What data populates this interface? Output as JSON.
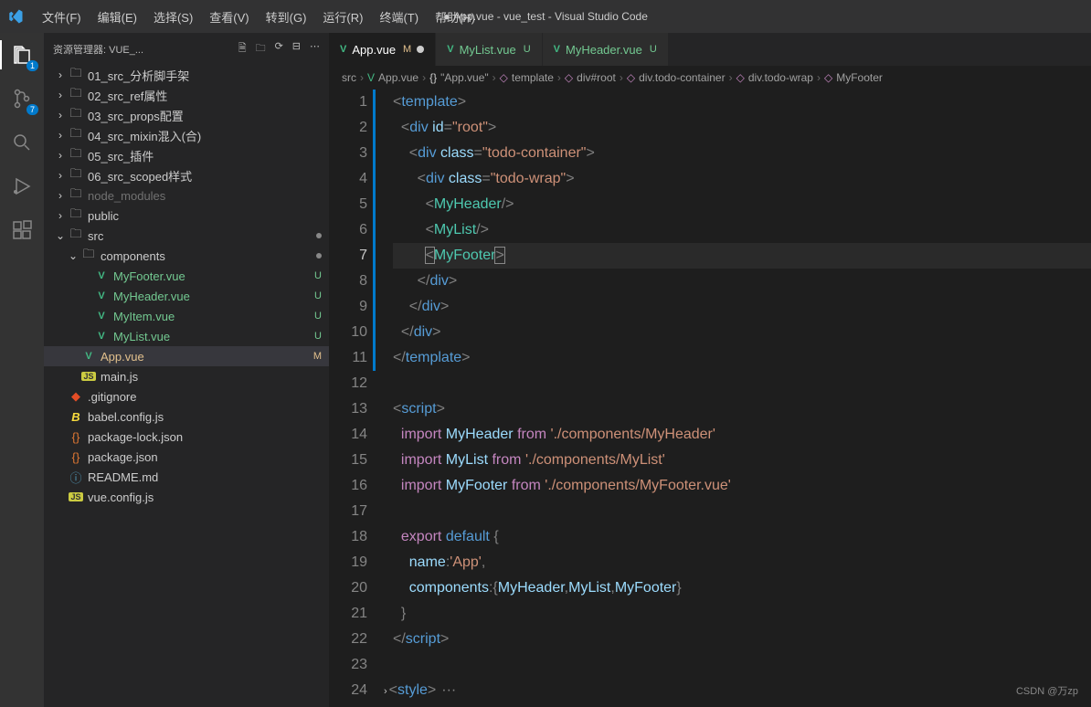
{
  "title": {
    "dirty": "●",
    "text": "App.vue - vue_test - Visual Studio Code"
  },
  "menu": [
    "文件(F)",
    "编辑(E)",
    "选择(S)",
    "查看(V)",
    "转到(G)",
    "运行(R)",
    "终端(T)",
    "帮助(H)"
  ],
  "activity": {
    "explorer_badge": "1",
    "scm_badge": "7"
  },
  "sidebar": {
    "title": "资源管理器: VUE_...",
    "tree": [
      {
        "indent": 0,
        "chevron": "›",
        "type": "folder",
        "label": "01_src_分析脚手架"
      },
      {
        "indent": 0,
        "chevron": "›",
        "type": "folder",
        "label": "02_src_ref属性"
      },
      {
        "indent": 0,
        "chevron": "›",
        "type": "folder",
        "label": "03_src_props配置"
      },
      {
        "indent": 0,
        "chevron": "›",
        "type": "folder",
        "label": "04_src_mixin混入(合)"
      },
      {
        "indent": 0,
        "chevron": "›",
        "type": "folder",
        "label": "05_src_插件"
      },
      {
        "indent": 0,
        "chevron": "›",
        "type": "folder",
        "label": "06_src_scoped样式"
      },
      {
        "indent": 0,
        "chevron": "›",
        "type": "folder",
        "label": "node_modules",
        "dim": true
      },
      {
        "indent": 0,
        "chevron": "›",
        "type": "folder",
        "label": "public"
      },
      {
        "indent": 0,
        "chevron": "⌄",
        "type": "folder",
        "label": "src",
        "dot": true
      },
      {
        "indent": 1,
        "chevron": "⌄",
        "type": "folder",
        "label": "components",
        "dot": true
      },
      {
        "indent": 2,
        "chevron": "",
        "type": "vue",
        "label": "MyFooter.vue",
        "badge": "U",
        "green": true
      },
      {
        "indent": 2,
        "chevron": "",
        "type": "vue",
        "label": "MyHeader.vue",
        "badge": "U",
        "green": true
      },
      {
        "indent": 2,
        "chevron": "",
        "type": "vue",
        "label": "MyItem.vue",
        "badge": "U",
        "green": true
      },
      {
        "indent": 2,
        "chevron": "",
        "type": "vue",
        "label": "MyList.vue",
        "badge": "U",
        "green": true
      },
      {
        "indent": 1,
        "chevron": "",
        "type": "vue",
        "label": "App.vue",
        "badge": "M",
        "selected": true,
        "yellow": true
      },
      {
        "indent": 1,
        "chevron": "",
        "type": "js",
        "label": "main.js"
      },
      {
        "indent": 0,
        "chevron": "",
        "type": "git",
        "label": ".gitignore"
      },
      {
        "indent": 0,
        "chevron": "",
        "type": "babel",
        "label": "babel.config.js"
      },
      {
        "indent": 0,
        "chevron": "",
        "type": "json",
        "label": "package-lock.json"
      },
      {
        "indent": 0,
        "chevron": "",
        "type": "json",
        "label": "package.json"
      },
      {
        "indent": 0,
        "chevron": "",
        "type": "md",
        "label": "README.md"
      },
      {
        "indent": 0,
        "chevron": "",
        "type": "js",
        "label": "vue.config.js"
      }
    ]
  },
  "tabs": [
    {
      "icon": "V",
      "label": "App.vue",
      "status": "M",
      "dirty": true,
      "active": true
    },
    {
      "icon": "V",
      "label": "MyList.vue",
      "status": "U"
    },
    {
      "icon": "V",
      "label": "MyHeader.vue",
      "status": "U"
    }
  ],
  "breadcrumbs": [
    {
      "label": "src"
    },
    {
      "icon": "V",
      "label": "App.vue",
      "cls": "file"
    },
    {
      "icon": "{}",
      "label": "\"App.vue\"",
      "cls": "brace"
    },
    {
      "icon": "◇",
      "label": "template"
    },
    {
      "icon": "◇",
      "label": "div#root"
    },
    {
      "icon": "◇",
      "label": "div.todo-container"
    },
    {
      "icon": "◇",
      "label": "div.todo-wrap"
    },
    {
      "icon": "◇",
      "label": "MyFooter"
    }
  ],
  "code": {
    "lines": [
      {
        "n": 1,
        "html": "<span class='tok-punct'>&lt;</span><span class='tok-tag'>template</span><span class='tok-punct'>&gt;</span>"
      },
      {
        "n": 2,
        "html": "  <span class='tok-punct'>&lt;</span><span class='tok-tag'>div</span> <span class='tok-attr'>id</span><span class='tok-punct'>=</span><span class='tok-str'>\"root\"</span><span class='tok-punct'>&gt;</span>"
      },
      {
        "n": 3,
        "html": "    <span class='tok-punct'>&lt;</span><span class='tok-tag'>div</span> <span class='tok-attr'>class</span><span class='tok-punct'>=</span><span class='tok-str'>\"todo-container\"</span><span class='tok-punct'>&gt;</span>"
      },
      {
        "n": 4,
        "html": "      <span class='tok-punct'>&lt;</span><span class='tok-tag'>div</span> <span class='tok-attr'>class</span><span class='tok-punct'>=</span><span class='tok-str'>\"todo-wrap\"</span><span class='tok-punct'>&gt;</span>"
      },
      {
        "n": 5,
        "html": "        <span class='tok-punct'>&lt;</span><span class='tok-comp'>MyHeader</span><span class='tok-punct'>/&gt;</span>"
      },
      {
        "n": 6,
        "html": "        <span class='tok-punct'>&lt;</span><span class='tok-comp'>MyList</span><span class='tok-punct'>/&gt;</span>"
      },
      {
        "n": 7,
        "active": true,
        "html": "        <span class='cursor-box'><span class='tok-punct'>&lt;</span></span><span class='tok-comp'>MyFooter</span><span class='cursor-box'><span class='tok-punct'>&gt;</span></span>"
      },
      {
        "n": 8,
        "html": "      <span class='tok-punct'>&lt;/</span><span class='tok-tag'>div</span><span class='tok-punct'>&gt;</span>"
      },
      {
        "n": 9,
        "html": "    <span class='tok-punct'>&lt;/</span><span class='tok-tag'>div</span><span class='tok-punct'>&gt;</span>"
      },
      {
        "n": 10,
        "html": "  <span class='tok-punct'>&lt;/</span><span class='tok-tag'>div</span><span class='tok-punct'>&gt;</span>"
      },
      {
        "n": 11,
        "html": "<span class='tok-punct'>&lt;/</span><span class='tok-tag'>template</span><span class='tok-punct'>&gt;</span>"
      },
      {
        "n": 12,
        "html": ""
      },
      {
        "n": 13,
        "html": "<span class='tok-punct'>&lt;</span><span class='tok-tag'>script</span><span class='tok-punct'>&gt;</span>"
      },
      {
        "n": 14,
        "html": "  <span class='tok-kw'>import</span> <span class='tok-var'>MyHeader</span> <span class='tok-from'>from</span> <span class='tok-str'>'./components/MyHeader'</span>"
      },
      {
        "n": 15,
        "html": "  <span class='tok-kw'>import</span> <span class='tok-var'>MyList</span> <span class='tok-from'>from</span> <span class='tok-str'>'./components/MyList'</span>"
      },
      {
        "n": 16,
        "html": "  <span class='tok-kw'>import</span> <span class='tok-var'>MyFooter</span> <span class='tok-from'>from</span> <span class='tok-str'>'./components/MyFooter.vue'</span>"
      },
      {
        "n": 17,
        "html": ""
      },
      {
        "n": 18,
        "html": "  <span class='tok-kw'>export</span> <span class='tok-def'>default</span> <span class='tok-punct'>{</span>"
      },
      {
        "n": 19,
        "html": "    <span class='tok-var'>name</span><span class='tok-punct'>:</span><span class='tok-str'>'App'</span><span class='tok-punct'>,</span>"
      },
      {
        "n": 20,
        "html": "    <span class='tok-var'>components</span><span class='tok-punct'>:{</span><span class='tok-var'>MyHeader</span><span class='tok-punct'>,</span><span class='tok-var'>MyList</span><span class='tok-punct'>,</span><span class='tok-var'>MyFooter</span><span class='tok-punct'>}</span>"
      },
      {
        "n": 21,
        "html": "  <span class='tok-punct'>}</span>"
      },
      {
        "n": 22,
        "html": "<span class='tok-punct'>&lt;/</span><span class='tok-tag'>script</span><span class='tok-punct'>&gt;</span>"
      },
      {
        "n": 23,
        "html": ""
      },
      {
        "n": 24,
        "fold": true,
        "html": "<span class='tok-punct'>&lt;</span><span class='tok-tag'>style</span><span class='tok-punct'>&gt;</span><span class='fold'>···</span>"
      }
    ]
  },
  "watermark": "CSDN @万zp"
}
